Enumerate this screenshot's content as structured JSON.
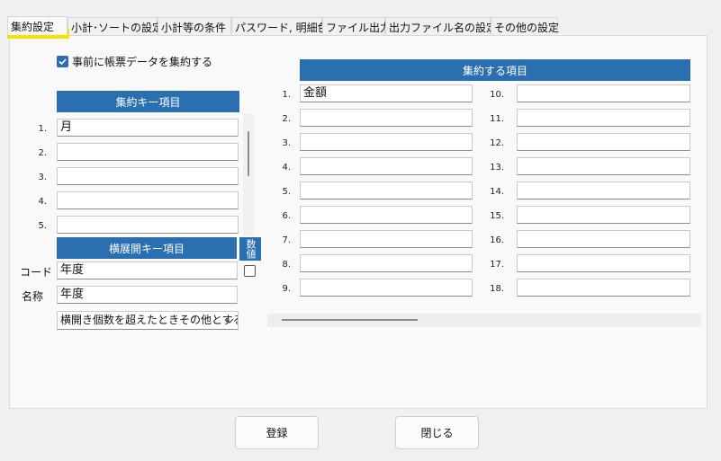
{
  "tabs": [
    {
      "label": "集約設定"
    },
    {
      "label": "小計･ソートの設定"
    },
    {
      "label": "小計等の条件"
    },
    {
      "label": "パスワード, 明細色"
    },
    {
      "label": "ファイル出力"
    },
    {
      "label": "出力ファイル名の設定"
    },
    {
      "label": "その他の設定"
    }
  ],
  "active_tab": "集約設定",
  "colors": {
    "accent": "#2a6fb0",
    "highlight": "#f2e600"
  },
  "pre_aggregate": {
    "label": "事前に帳票データを集約する",
    "checked": true
  },
  "keys": {
    "header": "集約キー項目",
    "rows": [
      {
        "num": "1.",
        "value": "月"
      },
      {
        "num": "2.",
        "value": ""
      },
      {
        "num": "3.",
        "value": ""
      },
      {
        "num": "4.",
        "value": ""
      },
      {
        "num": "5.",
        "value": ""
      }
    ]
  },
  "horizontal": {
    "header": "横展開キー項目",
    "numeric_header": "数値",
    "code_label": "コード",
    "code_value": "年度",
    "name_label": "名称",
    "name_value": "年度",
    "numeric_checked": false,
    "overflow_option": "横開き個数を超えたときその他とする"
  },
  "items": {
    "header": "集約する項目",
    "left": [
      {
        "num": "1.",
        "value": "金額"
      },
      {
        "num": "2.",
        "value": ""
      },
      {
        "num": "3.",
        "value": ""
      },
      {
        "num": "4.",
        "value": ""
      },
      {
        "num": "5.",
        "value": ""
      },
      {
        "num": "6.",
        "value": ""
      },
      {
        "num": "7.",
        "value": ""
      },
      {
        "num": "8.",
        "value": ""
      },
      {
        "num": "9.",
        "value": ""
      }
    ],
    "right": [
      {
        "num": "10.",
        "value": ""
      },
      {
        "num": "11.",
        "value": ""
      },
      {
        "num": "12.",
        "value": ""
      },
      {
        "num": "13.",
        "value": ""
      },
      {
        "num": "14.",
        "value": ""
      },
      {
        "num": "15.",
        "value": ""
      },
      {
        "num": "16.",
        "value": ""
      },
      {
        "num": "17.",
        "value": ""
      },
      {
        "num": "18.",
        "value": ""
      }
    ]
  },
  "buttons": {
    "register": "登録",
    "close": "閉じる"
  }
}
